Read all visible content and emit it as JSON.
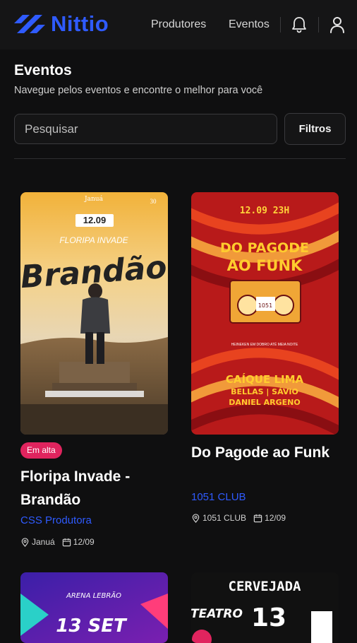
{
  "header": {
    "logo_text": "Nittio",
    "nav": [
      "Produtores",
      "Eventos"
    ],
    "brand_color": "#2f5bff"
  },
  "page": {
    "title": "Eventos",
    "subtitle": "Navegue pelos eventos e encontre o melhor para você"
  },
  "search": {
    "placeholder": "Pesquisar"
  },
  "filters_label": "Filtros",
  "events": [
    {
      "badge": "Em alta",
      "title": "Floripa Invade - Brandão",
      "producer": "CSS Produtora",
      "venue": "Januá",
      "date": "12/09",
      "poster": {
        "date": "12.09",
        "headline": "Brandão",
        "sub": "FLORIPA INVADE",
        "brand": "Januá",
        "age": "30"
      }
    },
    {
      "title": "Do Pagode ao Funk",
      "producer": "1051 CLUB",
      "venue": "1051 CLUB",
      "date": "12/09",
      "poster": {
        "date": "12.09  23H",
        "headline1": "DO PAGODE",
        "headline2": "AO FUNK",
        "line1": "CAÍQUE LIMA",
        "line2": "BELLAS | SÁVIO",
        "line3": "DANIEL ARGENO",
        "tag": "HEINEKEN EM DOBRO ATÉ MEIA NOITE",
        "badge": "1051"
      }
    },
    {
      "poster": {
        "top": "ARENA LEBRÃO",
        "date": "13 SET"
      }
    },
    {
      "poster": {
        "top": "CERVEJADA",
        "venue": "TEATRO",
        "day": "13"
      }
    }
  ],
  "icons": [
    "bell-icon",
    "user-icon",
    "location-icon",
    "calendar-icon"
  ]
}
